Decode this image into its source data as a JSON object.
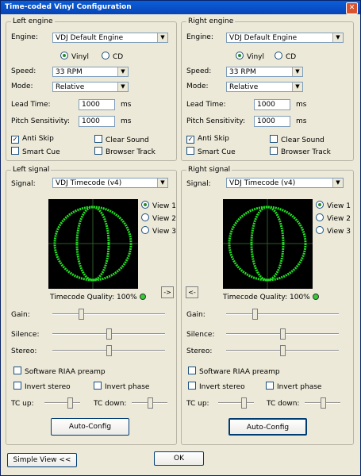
{
  "window": {
    "title": "Time-coded Vinyl Configuration"
  },
  "labels": {
    "engine": "Engine:",
    "speed": "Speed:",
    "mode": "Mode:",
    "lead_time": "Lead Time:",
    "pitch_sensitivity": "Pitch Sensitivity:",
    "ms": "ms",
    "signal": "Signal:",
    "gain": "Gain:",
    "silence": "Silence:",
    "stereo": "Stereo:",
    "tc_up": "TC up:",
    "tc_down": "TC down:",
    "vinyl": "Vinyl",
    "cd": "CD",
    "view1": "View 1",
    "view2": "View 2",
    "view3": "View 3"
  },
  "left_engine": {
    "title": "Left engine",
    "engine": "VDJ Default Engine",
    "media": "Vinyl",
    "speed": "33 RPM",
    "mode": "Relative",
    "lead_time": "1000",
    "pitch_sensitivity": "1000",
    "anti_skip": {
      "label": "Anti Skip",
      "checked": true
    },
    "clear_sound": {
      "label": "Clear Sound",
      "checked": false
    },
    "smart_cue": {
      "label": "Smart Cue",
      "checked": false
    },
    "browser_track": {
      "label": "Browser Track",
      "checked": false
    }
  },
  "right_engine": {
    "title": "Right engine",
    "engine": "VDJ Default Engine",
    "media": "Vinyl",
    "speed": "33 RPM",
    "mode": "Relative",
    "lead_time": "1000",
    "pitch_sensitivity": "1000",
    "anti_skip": {
      "label": "Anti Skip",
      "checked": true
    },
    "clear_sound": {
      "label": "Clear Sound",
      "checked": false
    },
    "smart_cue": {
      "label": "Smart Cue",
      "checked": false
    },
    "browser_track": {
      "label": "Browser Track",
      "checked": false
    }
  },
  "left_signal": {
    "title": "Left signal",
    "signal": "VDJ Timecode (v4)",
    "view": "View 1",
    "quality": "Timecode Quality: 100%",
    "copy_button": "->",
    "gain": 0.25,
    "silence": 0.5,
    "stereo": 0.5,
    "tc_up": 0.7,
    "tc_down": 0.5,
    "riaa": {
      "label": "Software RIAA preamp",
      "checked": false
    },
    "invert_stereo": {
      "label": "Invert stereo",
      "checked": false
    },
    "invert_phase": {
      "label": "Invert phase",
      "checked": false
    },
    "autoconfig": "Auto-Config"
  },
  "right_signal": {
    "title": "Right signal",
    "signal": "VDJ Timecode (v4)",
    "view": "View 1",
    "quality": "Timecode Quality: 100%",
    "copy_button": "<-",
    "gain": 0.25,
    "silence": 0.5,
    "stereo": 0.5,
    "tc_up": 0.7,
    "tc_down": 0.5,
    "riaa": {
      "label": "Software RIAA preamp",
      "checked": false
    },
    "invert_stereo": {
      "label": "Invert stereo",
      "checked": false
    },
    "invert_phase": {
      "label": "Invert phase",
      "checked": false
    },
    "autoconfig": "Auto-Config"
  },
  "footer": {
    "simple_view": "Simple View <<",
    "ok": "OK"
  },
  "colors": {
    "scope_trace": "#22dd22",
    "scope_bg": "#000000",
    "title_bar": "#0b5fd8"
  }
}
